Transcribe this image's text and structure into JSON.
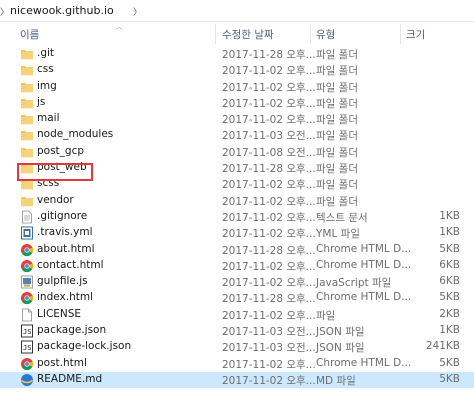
{
  "breadcrumb": {
    "path": "nicewook.github.io",
    "leading_chevron_icon": "chevron-right-icon",
    "trailing_chevron_icon": "chevron-right-icon"
  },
  "columns": {
    "name": "이름",
    "date": "수정한 날짜",
    "type": "유형",
    "size": "크기"
  },
  "files": [
    {
      "name": ".git",
      "date": "2017-11-28 오후...",
      "type": "파일 폴더",
      "size": "",
      "icon": "folder-icon"
    },
    {
      "name": "css",
      "date": "2017-11-02 오후...",
      "type": "파일 폴더",
      "size": "",
      "icon": "folder-icon"
    },
    {
      "name": "img",
      "date": "2017-11-02 오후...",
      "type": "파일 폴더",
      "size": "",
      "icon": "folder-icon"
    },
    {
      "name": "js",
      "date": "2017-11-02 오후...",
      "type": "파일 폴더",
      "size": "",
      "icon": "folder-icon"
    },
    {
      "name": "mail",
      "date": "2017-11-02 오후...",
      "type": "파일 폴더",
      "size": "",
      "icon": "folder-icon"
    },
    {
      "name": "node_modules",
      "date": "2017-11-03 오전...",
      "type": "파일 폴더",
      "size": "",
      "icon": "folder-icon"
    },
    {
      "name": "post_gcp",
      "date": "2017-11-08 오전...",
      "type": "파일 폴더",
      "size": "",
      "icon": "folder-icon"
    },
    {
      "name": "post_web",
      "date": "2017-11-28 오후...",
      "type": "파일 폴더",
      "size": "",
      "icon": "folder-icon"
    },
    {
      "name": "scss",
      "date": "2017-11-02 오후...",
      "type": "파일 폴더",
      "size": "",
      "icon": "folder-icon"
    },
    {
      "name": "vendor",
      "date": "2017-11-02 오후...",
      "type": "파일 폴더",
      "size": "",
      "icon": "folder-icon"
    },
    {
      "name": ".gitignore",
      "date": "2017-11-02 오후...",
      "type": "텍스트 문서",
      "size": "1KB",
      "icon": "text-file-icon"
    },
    {
      "name": ".travis.yml",
      "date": "2017-11-02 오후...",
      "type": "YML 파일",
      "size": "1KB",
      "icon": "yml-file-icon"
    },
    {
      "name": "about.html",
      "date": "2017-11-28 오후...",
      "type": "Chrome HTML D...",
      "size": "5KB",
      "icon": "chrome-icon"
    },
    {
      "name": "contact.html",
      "date": "2017-11-02 오후...",
      "type": "Chrome HTML D...",
      "size": "6KB",
      "icon": "chrome-icon"
    },
    {
      "name": "gulpfile.js",
      "date": "2017-11-02 오후...",
      "type": "JavaScript 파일",
      "size": "6KB",
      "icon": "js-file-icon"
    },
    {
      "name": "index.html",
      "date": "2017-11-28 오후...",
      "type": "Chrome HTML D...",
      "size": "5KB",
      "icon": "chrome-icon"
    },
    {
      "name": "LICENSE",
      "date": "2017-11-02 오후...",
      "type": "파일",
      "size": "2KB",
      "icon": "blank-file-icon"
    },
    {
      "name": "package.json",
      "date": "2017-11-03 오전...",
      "type": "JSON 파일",
      "size": "1KB",
      "icon": "json-file-icon"
    },
    {
      "name": "package-lock.json",
      "date": "2017-11-03 오전...",
      "type": "JSON 파일",
      "size": "241KB",
      "icon": "json-file-icon"
    },
    {
      "name": "post.html",
      "date": "2017-11-02 오후...",
      "type": "Chrome HTML D...",
      "size": "5KB",
      "icon": "chrome-icon"
    },
    {
      "name": "README.md",
      "date": "2017-11-02 오후...",
      "type": "MD 파일",
      "size": "5KB",
      "icon": "md-file-icon",
      "selected": true
    }
  ],
  "colors": {
    "selection": "#cce8ff",
    "highlight_box": "#e0393e",
    "folder": "#f1c35a",
    "header_text": "#4d6082"
  }
}
